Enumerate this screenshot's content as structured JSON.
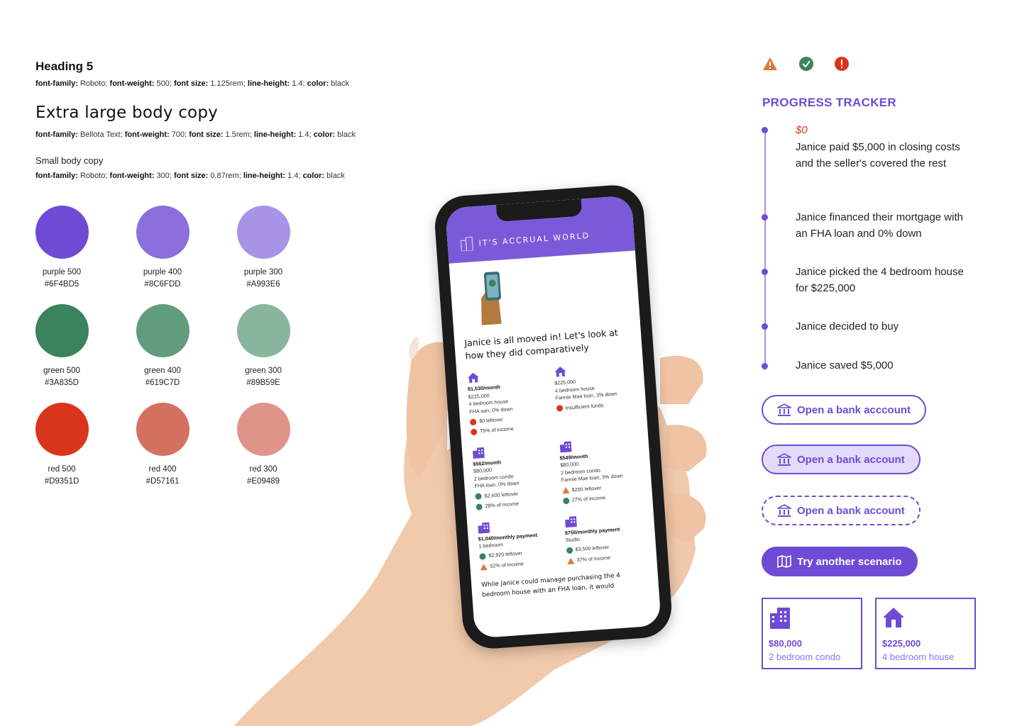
{
  "typography": {
    "heading5": {
      "label": "Heading 5",
      "spec": {
        "family_key": "font-family:",
        "family_val": " Roboto; ",
        "weight_key": "font-weight:",
        "weight_val": " 500; ",
        "size_key": "font size:",
        "size_val": " 1.125rem; ",
        "lh_key": "line-height:",
        "lh_val": " 1.4; ",
        "color_key": "color:",
        "color_val": " black"
      }
    },
    "xl_body": {
      "label": "Extra large body copy",
      "spec": {
        "family_key": "font-family:",
        "family_val": " Bellota Text; ",
        "weight_key": "font-weight:",
        "weight_val": " 700; ",
        "size_key": "font size:",
        "size_val": " 1.5rem; ",
        "lh_key": "line-height:",
        "lh_val": " 1.4; ",
        "color_key": "color:",
        "color_val": " black"
      }
    },
    "small_body": {
      "label": "Small body copy",
      "spec": {
        "family_key": "font-family:",
        "family_val": " Roboto; ",
        "weight_key": "font-weight:",
        "weight_val": " 300; ",
        "size_key": "font size:",
        "size_val": " 0.87rem; ",
        "lh_key": "line-height:",
        "lh_val": " 1.4; ",
        "color_key": "color:",
        "color_val": " black"
      }
    }
  },
  "swatches": [
    {
      "name": "purple 500",
      "hex": "#6F4BD5",
      "color": "#6f4bd5"
    },
    {
      "name": "purple 400",
      "hex": "#8C6FDD",
      "color": "#8c6fdd"
    },
    {
      "name": "purple 300",
      "hex": "#A993E6",
      "color": "#a993e6"
    },
    {
      "name": "green 500",
      "hex": "#3A835D",
      "color": "#3a835d"
    },
    {
      "name": "green 400",
      "hex": "#619C7D",
      "color": "#619c7d"
    },
    {
      "name": "green 300",
      "hex": "#89B59E",
      "color": "#89b59e"
    },
    {
      "name": "red 500",
      "hex": "#D9351D",
      "color": "#d9351d"
    },
    {
      "name": "red 400",
      "hex": "#D57161",
      "color": "#d57161"
    },
    {
      "name": "red 300",
      "hex": "#E09489",
      "color": "#e09489"
    }
  ],
  "phone": {
    "brand": "IT'S ACCRUAL WORLD",
    "heading": "Janice is all moved in! Let's look at how they did comparatively",
    "cells": [
      {
        "icon": "house-icon",
        "lines": [
          "$1,530/month",
          "$225,000",
          "4 bedroom house",
          "FHA oan, 0% down"
        ],
        "status": [
          {
            "type": "error",
            "text": "$0 leftover"
          },
          {
            "type": "error",
            "text": "75% of income"
          }
        ]
      },
      {
        "icon": "house-icon",
        "lines": [
          "",
          "$225,000",
          "4 bedroom house",
          "Fannie Mae loan, 3% down"
        ],
        "status": [
          {
            "type": "error",
            "text": "Insufficient funds"
          }
        ]
      },
      {
        "icon": "building-icon",
        "lines": [
          "$562/month",
          "$80,000",
          "2 bedroom condo",
          "FHA loan, 0% down"
        ],
        "status": [
          {
            "type": "ok",
            "text": "$2,600 leftover"
          },
          {
            "type": "ok",
            "text": "28% of income"
          }
        ]
      },
      {
        "icon": "building-icon",
        "lines": [
          "$549/month",
          "$80,000",
          "2 bedroom condo",
          "Fannie Mae loan, 3% down"
        ],
        "status": [
          {
            "type": "warn",
            "text": "$200 leftover"
          },
          {
            "type": "ok",
            "text": "27% of income"
          }
        ]
      },
      {
        "icon": "building-icon",
        "lines": [
          "$1,040/monthly payment",
          "1 bedroom"
        ],
        "status": [
          {
            "type": "ok",
            "text": "$2,920 leftover"
          },
          {
            "type": "warn",
            "text": "52% of income"
          }
        ]
      },
      {
        "icon": "building-icon",
        "lines": [
          "$750/monthly payment",
          "Studio"
        ],
        "status": [
          {
            "type": "ok",
            "text": "$3,500 leftover"
          },
          {
            "type": "warn",
            "text": "37% of income"
          }
        ]
      }
    ],
    "footer": "While Janice could manage purchasing the 4 bedroom house with an FHA loan, it would"
  },
  "tracker": {
    "title": "PROGRESS TRACKER",
    "zero": "$0",
    "steps": [
      "Janice paid $5,000 in closing costs and the seller's covered the rest",
      "Janice financed their mortgage with an FHA loan and 0% down",
      "Janice picked the 4 bedroom house for $225,000",
      "Janice decided to buy",
      "Janice saved $5,000"
    ]
  },
  "buttons": {
    "open1": "Open a bank acccount",
    "open2": "Open a bank account",
    "open3": "Open a bank account",
    "scenario": "Try another scenario"
  },
  "cards": [
    {
      "price": "$80,000",
      "desc": "2 bedroom condo"
    },
    {
      "price": "$225,000",
      "desc": "4 bedroom house"
    }
  ]
}
